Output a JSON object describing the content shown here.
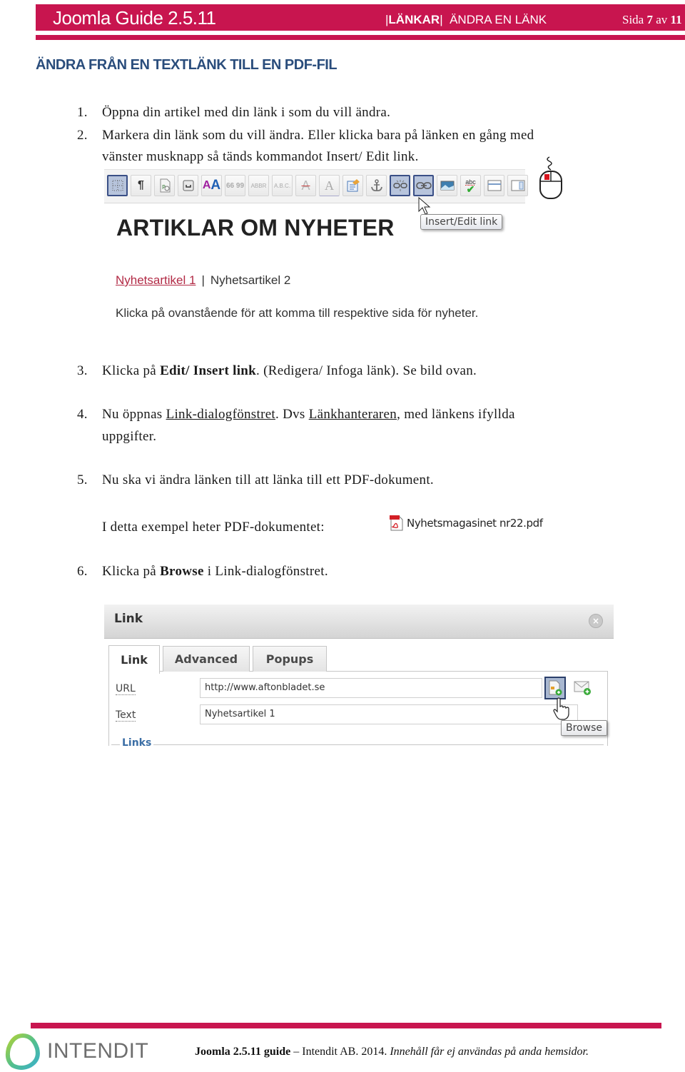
{
  "header": {
    "title": "Joomla Guide 2.5.11",
    "section": "LÄNKAR",
    "subsection": "ÄNDRA EN LÄNK",
    "page_prefix": "Sida",
    "page_current": "7",
    "page_sep": "av",
    "page_total": "11",
    "brand_color": "#c8154f"
  },
  "heading": "ÄNDRA FRÅN EN TEXTLÄNK TILL EN PDF-FIL",
  "steps": [
    {
      "num": "1.",
      "text": "Öppna din artikel med din länk i som du vill ändra."
    },
    {
      "num": "2.",
      "line1": "Markera din länk som du vill ändra. Eller klicka bara på länken en gång med",
      "line2": "vänster musknapp så tänds kommandot Insert/ Edit link."
    },
    {
      "num": "3.",
      "pre": "Klicka på ",
      "bold": "Edit/ Insert link",
      "post": ". (Redigera/ Infoga länk). Se bild ovan."
    },
    {
      "num": "4.",
      "pre": "Nu öppnas ",
      "link1": "Link-dialogfönstret",
      "mid": ". Dvs ",
      "link2": "Länkhanteraren",
      "post": ", med länkens ifyllda",
      "line2": "uppgifter."
    },
    {
      "num": "5.",
      "text": "Nu ska vi ändra länken till att länka till ett PDF-dokument."
    },
    {
      "num": "",
      "text": "I detta exempel heter PDF-dokumentet:"
    },
    {
      "num": "6.",
      "pre": "Klicka på ",
      "bold": "Browse",
      "post": " i Link-dialogfönstret."
    }
  ],
  "editor_screenshot": {
    "toolbar_buttons": [
      {
        "icon": "visual-aid-icon",
        "active": true
      },
      {
        "icon": "pilcrow-icon",
        "label": "¶"
      },
      {
        "icon": "template-icon"
      },
      {
        "icon": "insert-layer-icon"
      },
      {
        "icon": "styles-icon",
        "label": "AA"
      },
      {
        "icon": "quote-icon",
        "label": "66 99"
      },
      {
        "icon": "abbr-icon",
        "label": "ABBR"
      },
      {
        "icon": "acronym-icon",
        "label": "A.B.C."
      },
      {
        "icon": "strikethrough-icon",
        "label": "A"
      },
      {
        "icon": "text-color-icon",
        "label": "A"
      },
      {
        "icon": "attributes-icon"
      },
      {
        "icon": "anchor-icon"
      },
      {
        "icon": "unlink-icon",
        "active": true
      },
      {
        "icon": "link-icon",
        "active": true
      },
      {
        "icon": "image-icon"
      },
      {
        "icon": "spellcheck-icon",
        "label": "abc"
      },
      {
        "icon": "horizontal-rule-icon"
      },
      {
        "icon": "layer-icon"
      }
    ],
    "tooltip": "Insert/Edit link",
    "article_heading": "ARTIKLAR OM NYHETER",
    "link1": "Nyhetsartikel 1",
    "separator": "|",
    "link2": "Nyhetsartikel 2",
    "description": "Klicka på ovanstående för att komma till respektive sida för nyheter."
  },
  "pdf_file": {
    "name": "Nyhetsmagasinet nr22.pdf",
    "icon": "pdf-file-icon"
  },
  "link_dialog": {
    "title": "Link",
    "close": "×",
    "tabs": [
      {
        "label": "Link",
        "active": true
      },
      {
        "label": "Advanced",
        "active": false
      },
      {
        "label": "Popups",
        "active": false
      }
    ],
    "url_label": "URL",
    "url_value": "http://www.aftonbladet.se",
    "text_label": "Text",
    "text_value": "Nyhetsartikel 1",
    "browse_tooltip": "Browse",
    "links_legend": "Links"
  },
  "footer": {
    "logo_text": "INTENDIT",
    "guide_bold": "Joomla 2.5.11 guide",
    "dash": " – ",
    "company": "Intendit AB. 2014. ",
    "notice": "Innehåll får ej användas på anda hemsidor."
  }
}
